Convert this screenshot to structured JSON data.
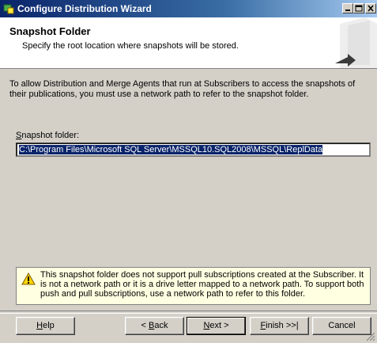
{
  "window": {
    "title": "Configure Distribution Wizard"
  },
  "header": {
    "title": "Snapshot Folder",
    "subtitle": "Specify the root location where snapshots will be stored."
  },
  "main": {
    "description": "To allow Distribution and Merge Agents that run at Subscribers to access the snapshots of their publications, you must use a network path to refer to the snapshot folder.",
    "folder_label_key": "S",
    "folder_label_rest": "napshot folder:",
    "folder_value": "C:\\Program Files\\Microsoft SQL Server\\MSSQL10.SQL2008\\MSSQL\\ReplData"
  },
  "warning": {
    "icon": "warning-icon",
    "text": "This snapshot folder does not support pull subscriptions created at the Subscriber. It is not a network path or it is a drive letter mapped to a network path. To support both push and pull subscriptions, use a network path to refer to this folder."
  },
  "buttons": {
    "help_key": "H",
    "help_rest": "elp",
    "back_prefix": "< ",
    "back_key": "B",
    "back_rest": "ack",
    "next_key": "N",
    "next_rest": "ext >",
    "finish_key": "F",
    "finish_rest": "inish >>|",
    "cancel": "Cancel"
  },
  "colors": {
    "title_bar": "#0a246a",
    "selection": "#0a246a",
    "warning_bg": "#ffffe1"
  }
}
